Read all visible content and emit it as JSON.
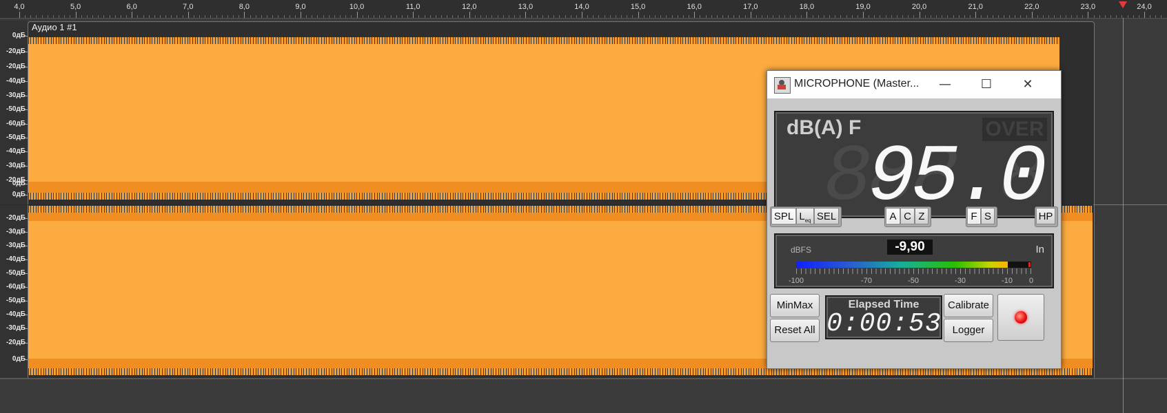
{
  "timeline": {
    "ticks": [
      "4,0",
      "5,0",
      "6,0",
      "7,0",
      "8,0",
      "9,0",
      "10,0",
      "11,0",
      "12,0",
      "13,0",
      "14,0",
      "15,0",
      "16,0",
      "17,0",
      "18,0",
      "19,0",
      "20,0",
      "21,0",
      "22,0",
      "23,0",
      "24,0"
    ]
  },
  "track": {
    "clip_name": "Аудио 1 #1",
    "db_labels_top": [
      "0дБ",
      "-20дБ",
      "-20дБ",
      "-40дБ",
      "-30дБ",
      "-50дБ",
      "-60дБ",
      "-50дБ",
      "-40дБ",
      "-30дБ",
      "-20дБ",
      "0дБ"
    ],
    "db_labels_bottom": [
      "0дБ",
      "-20дБ",
      "-30дБ",
      "-30дБ",
      "-40дБ",
      "-50дБ",
      "-60дБ",
      "-50дБ",
      "-40дБ",
      "-30дБ",
      "-20дБ",
      "0дБ"
    ],
    "wave_color": "#fbab40",
    "background_color": "#3b3b3b"
  },
  "meter": {
    "window_title": "MICROPHONE (Master...",
    "window_controls": {
      "minimize": "—",
      "maximize": "☐",
      "close": "✕"
    },
    "weighting_label": "dB(A) F",
    "over_label": "OVER",
    "ghost_digits": "888.8",
    "spl_value": "95.0",
    "mode_buttons": {
      "spl": "SPL",
      "leq": "L",
      "leq_sub": "eq",
      "sel": "SEL"
    },
    "freq_buttons": [
      "A",
      "C",
      "Z"
    ],
    "time_buttons": [
      "F",
      "S"
    ],
    "hp_button": "HP",
    "level": {
      "unit_label": "dBFS",
      "readout": "-9,90",
      "input_label": "In",
      "fill_fraction": 0.9,
      "scale": [
        "-100",
        "-70",
        "-50",
        "-30",
        "-10",
        "0"
      ]
    },
    "minmax_button": "MinMax",
    "reset_button": "Reset All",
    "elapsed_label": "Elapsed Time",
    "elapsed_value": "0:00:53",
    "calibrate_button": "Calibrate",
    "logger_button": "Logger",
    "accent_record": "#e11111"
  }
}
